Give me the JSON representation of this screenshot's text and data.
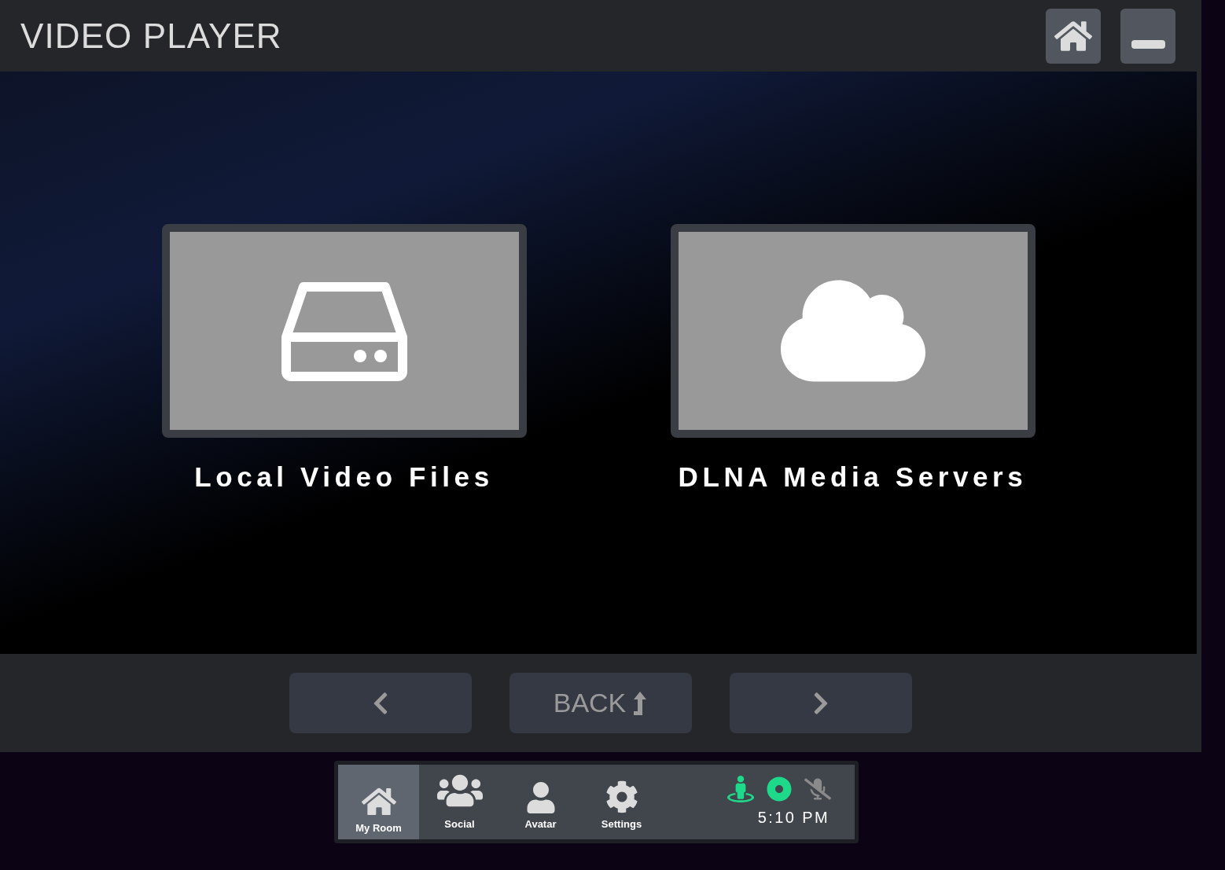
{
  "window": {
    "title": "VIDEO PLAYER"
  },
  "sources": [
    {
      "label": "Local Video Files",
      "kind": "drive"
    },
    {
      "label": "DLNA Media Servers",
      "kind": "cloud"
    }
  ],
  "navigation": {
    "back_label": "BACK"
  },
  "taskbar": {
    "items": [
      {
        "label": "My Room",
        "kind": "home",
        "selected": true
      },
      {
        "label": "Social",
        "kind": "social",
        "selected": false
      },
      {
        "label": "Avatar",
        "kind": "avatar",
        "selected": false
      },
      {
        "label": "Settings",
        "kind": "settings",
        "selected": false
      }
    ],
    "time": "5:10 PM"
  }
}
